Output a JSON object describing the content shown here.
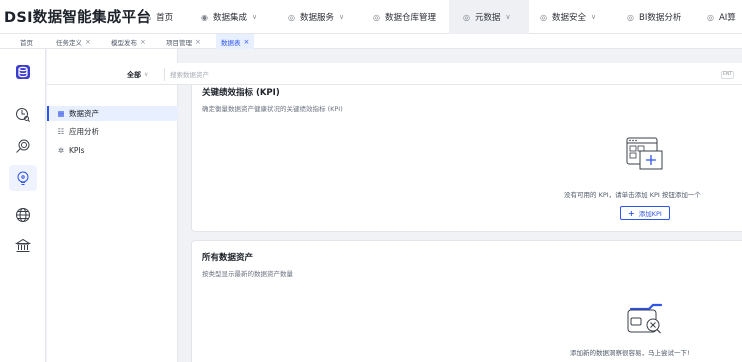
{
  "brand": "DSI数据智能集成平台",
  "nav": [
    {
      "label": "首页",
      "icon": "home-icon",
      "chevron": false
    },
    {
      "label": "数据集成",
      "icon": "integration-icon",
      "chevron": true
    },
    {
      "label": "数据服务",
      "icon": "service-icon",
      "chevron": true
    },
    {
      "label": "数据仓库管理",
      "icon": "warehouse-icon",
      "chevron": false
    },
    {
      "label": "元数据",
      "icon": "metadata-icon",
      "chevron": true
    },
    {
      "label": "数据安全",
      "icon": "security-icon",
      "chevron": true
    },
    {
      "label": "BI数据分析",
      "icon": "bi-icon",
      "chevron": false
    },
    {
      "label": "AI算",
      "icon": "ai-icon",
      "chevron": false
    }
  ],
  "nav_active": "元数据",
  "tabs": [
    {
      "label": "首页",
      "closable": false
    },
    {
      "label": "任务定义",
      "closable": true
    },
    {
      "label": "模型发布",
      "closable": true
    },
    {
      "label": "项目管理",
      "closable": true
    },
    {
      "label": "数据表",
      "closable": true
    }
  ],
  "tabs_active": "数据表",
  "close_glyph": "×",
  "sidebar": {
    "items": [
      {
        "label": "数据资产",
        "icon": "asset-icon"
      },
      {
        "label": "应用分析",
        "icon": "analysis-icon"
      },
      {
        "label": "KPIs",
        "icon": "kpi-icon"
      }
    ],
    "active": "数据资产"
  },
  "filter": {
    "scope_value": "全部",
    "search_placeholder": "搜索数据资产",
    "search_shortcut": "ENT"
  },
  "kpi_card": {
    "title": "关键绩效指标 (KPI)",
    "subtitle": "确定衡量数据资产健康状况的关键绩效指标 (KPI)",
    "empty_text": "没有可用的 KPI，请单击添加 KPI 按钮添加一个",
    "add_button": "添加KPI"
  },
  "assets_card": {
    "title": "所有数据资产",
    "subtitle": "按类型显示最新的数据资产数量",
    "empty_text": "添加新的数据洞察很容易，马上尝试一下!"
  },
  "colors": {
    "accent": "#2f54eb",
    "active_bg": "#e8f0ff"
  }
}
